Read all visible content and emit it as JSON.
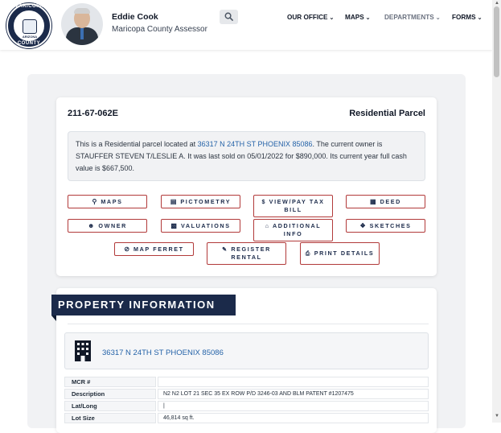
{
  "header": {
    "logo": {
      "top_text": "ARIZONA",
      "main_text": "MARICOPA",
      "bottom_text": "COUNTY"
    },
    "assessor_name": "Eddie Cook",
    "assessor_title": "Maricopa County Assessor",
    "search_icon": "search-icon",
    "nav": [
      {
        "label": "OUR OFFICE",
        "chevron": "chevron-down-icon"
      },
      {
        "label": "MAPS",
        "chevron": "chevron-down-icon"
      },
      {
        "label": "DEPARTMENTS",
        "chevron": "chevron-down-icon"
      },
      {
        "label": "FORMS",
        "chevron": "chevron-down-icon"
      }
    ]
  },
  "parcel": {
    "number": "211-67-062E",
    "type": "Residential Parcel",
    "summary_prefix": "This is a Residential parcel located at ",
    "summary_address": "36317 N 24TH ST PHOENIX 85086",
    "summary_suffix": ". The current owner is STAUFFER STEVEN T/LESLIE A. It was last sold on 05/01/2022 for $890,000. Its current year full cash value is $667,500."
  },
  "buttons": {
    "maps": {
      "label": "MAPS",
      "icon": "map-marker-icon"
    },
    "pictometry": {
      "label": "PICTOMETRY",
      "icon": "file-icon"
    },
    "tax": {
      "label": "VIEW/PAY TAX BILL",
      "icon": "dollar-icon"
    },
    "deed": {
      "label": "DEED",
      "icon": "building-icon"
    },
    "owner": {
      "label": "OWNER",
      "icon": "user-icon"
    },
    "valuations": {
      "label": "VALUATIONS",
      "icon": "money-icon"
    },
    "additional": {
      "label": "ADDITIONAL INFO",
      "icon": "home-icon"
    },
    "sketches": {
      "label": "SKETCHES",
      "icon": "sketch-icon"
    },
    "ferret": {
      "label": "MAP FERRET",
      "icon": "compass-icon"
    },
    "register": {
      "label": "REGISTER RENTAL",
      "icon": "edit-icon"
    },
    "print": {
      "label": "PRINT DETAILS",
      "icon": "print-icon"
    }
  },
  "property_info": {
    "heading": "PROPERTY INFORMATION",
    "address": "36317 N 24TH ST PHOENIX 85086",
    "rows": [
      {
        "label": "MCR #",
        "value": ""
      },
      {
        "label": "Description",
        "value": "N2 N2 LOT 21 SEC 35 EX ROW P/D 3246-03 AND BLM PATENT #1207475"
      },
      {
        "label": "Lat/Long",
        "value": "|"
      },
      {
        "label": "Lot Size",
        "value": "46,814 sq ft."
      }
    ]
  },
  "colors": {
    "navy": "#1b2a4a",
    "button_border": "#b23a3a",
    "link": "#2563a8"
  }
}
